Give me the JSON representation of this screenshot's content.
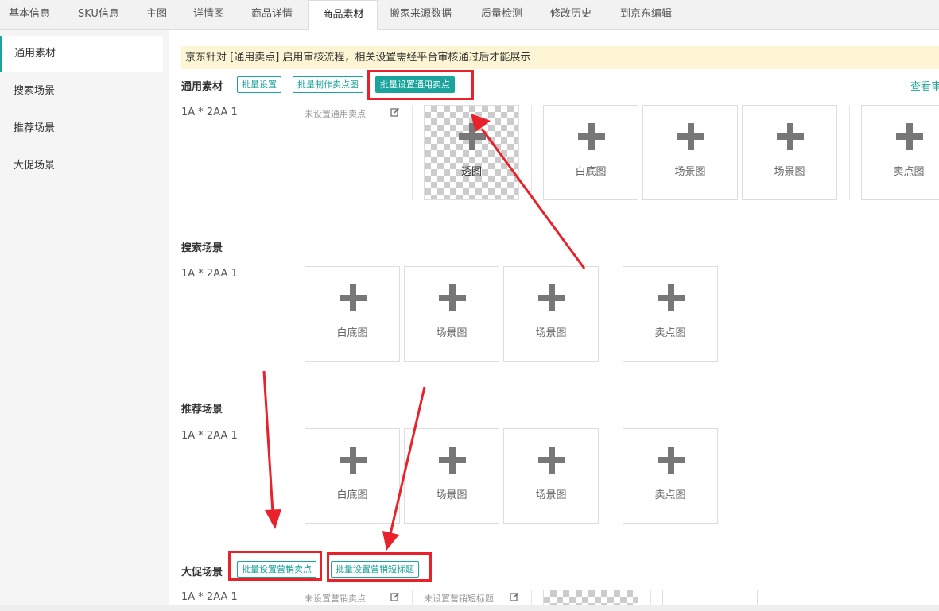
{
  "tabs": [
    {
      "label": "基本信息",
      "active": false
    },
    {
      "label": "SKU信息",
      "active": false
    },
    {
      "label": "主图",
      "active": false
    },
    {
      "label": "详情图",
      "active": false
    },
    {
      "label": "商品详情",
      "active": false
    },
    {
      "label": "商品素材",
      "active": true
    },
    {
      "label": "搬家来源数据",
      "active": false
    },
    {
      "label": "质量检测",
      "active": false
    },
    {
      "label": "修改历史",
      "active": false
    },
    {
      "label": "到京东编辑",
      "active": false
    }
  ],
  "sidebar": {
    "items": [
      {
        "label": "通用素材",
        "active": true
      },
      {
        "label": "搜索场景",
        "active": false
      },
      {
        "label": "推荐场景",
        "active": false
      },
      {
        "label": "大促场景",
        "active": false
      }
    ]
  },
  "notice": "京东针对 [通用卖点] 启用审核流程，相关设置需经平台审核通过后才能展示",
  "general": {
    "title": "通用素材",
    "btn_batch": "批量设置",
    "btn_make_selling": "批量制作卖点图",
    "btn_set_selling": "批量设置通用卖点",
    "view_link": "查看审",
    "sku": "1A * 2AA 1",
    "selling_status": "未设置通用卖点",
    "slots": [
      "透图",
      "白底图",
      "场景图",
      "场景图",
      "卖点图"
    ]
  },
  "search": {
    "title": "搜索场景",
    "sku": "1A * 2AA 1",
    "slots": [
      "白底图",
      "场景图",
      "场景图",
      "卖点图"
    ]
  },
  "recommend": {
    "title": "推荐场景",
    "sku": "1A * 2AA 1",
    "slots": [
      "白底图",
      "场景图",
      "场景图",
      "卖点图"
    ]
  },
  "promo": {
    "title": "大促场景",
    "btn_selling": "批量设置营销卖点",
    "btn_short": "批量设置营销短标题",
    "sku": "1A * 2AA 1",
    "selling_status": "未设置营销卖点",
    "short_status": "未设置营销短标题"
  },
  "colors": {
    "accent": "#1aa49b",
    "highlight": "#e8212a",
    "notice_bg": "#fef5d5"
  },
  "icons": {
    "edit": "edit-icon",
    "add": "plus-icon"
  }
}
